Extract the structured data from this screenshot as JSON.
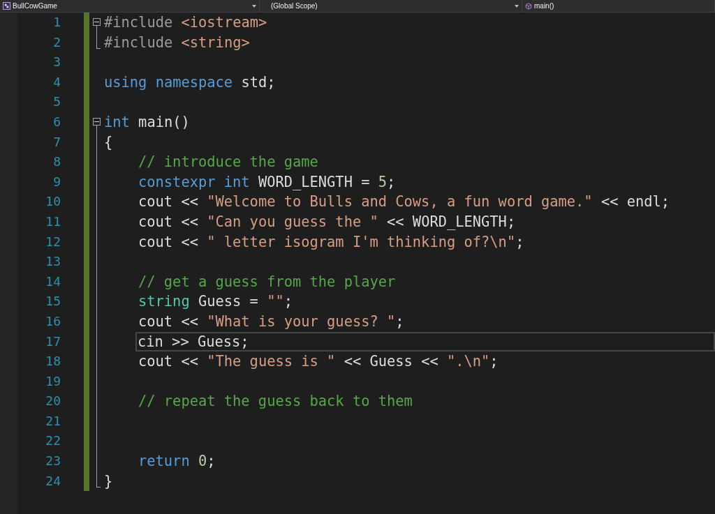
{
  "navigation_bar": {
    "project": "BullCowGame",
    "scope": "(Global Scope)",
    "member": "main()"
  },
  "lines": [
    {
      "number": "1",
      "changed": true,
      "fold_toggle": true,
      "in_block": false,
      "block_end": false,
      "indented": false,
      "tokens": [
        {
          "kind": "preprocessor",
          "text": "#include "
        },
        {
          "kind": "string",
          "text": "<iostream>"
        }
      ]
    },
    {
      "number": "2",
      "changed": true,
      "fold_toggle": false,
      "in_block": false,
      "block_end": true,
      "indented": false,
      "tokens": [
        {
          "kind": "preprocessor",
          "text": "#include "
        },
        {
          "kind": "string",
          "text": "<string>"
        }
      ]
    },
    {
      "number": "3",
      "changed": true,
      "fold_toggle": false,
      "in_block": false,
      "block_end": false,
      "indented": false
    },
    {
      "number": "4",
      "changed": true,
      "fold_toggle": false,
      "in_block": false,
      "block_end": false,
      "indented": false,
      "tokens": [
        {
          "kind": "keyword",
          "text": "using namespace "
        },
        {
          "kind": "plain",
          "text": "std;"
        }
      ]
    },
    {
      "number": "5",
      "changed": true,
      "fold_toggle": false,
      "in_block": false,
      "block_end": false,
      "indented": false
    },
    {
      "number": "6",
      "changed": true,
      "fold_toggle": true,
      "in_block": false,
      "block_end": false,
      "indented": false,
      "tokens": [
        {
          "kind": "keyword",
          "text": "int "
        },
        {
          "kind": "plain",
          "text": "main()"
        }
      ]
    },
    {
      "number": "7",
      "changed": true,
      "fold_toggle": false,
      "in_block": true,
      "block_end": false,
      "indented": false,
      "tokens": [
        {
          "kind": "plain",
          "text": "{"
        }
      ]
    },
    {
      "number": "8",
      "changed": true,
      "fold_toggle": false,
      "in_block": true,
      "block_end": false,
      "indented": true,
      "tokens": [
        {
          "kind": "comment",
          "text": "// introduce the game"
        }
      ]
    },
    {
      "number": "9",
      "changed": true,
      "fold_toggle": false,
      "in_block": true,
      "block_end": false,
      "indented": true,
      "tokens": [
        {
          "kind": "keyword",
          "text": "constexpr int "
        },
        {
          "kind": "plain",
          "text": "WORD_LENGTH = "
        },
        {
          "kind": "number",
          "text": "5"
        },
        {
          "kind": "plain",
          "text": ";"
        }
      ]
    },
    {
      "number": "10",
      "changed": true,
      "fold_toggle": false,
      "in_block": true,
      "block_end": false,
      "indented": true,
      "tokens": [
        {
          "kind": "plain",
          "text": "cout << "
        },
        {
          "kind": "string",
          "text": "\"Welcome to Bulls and Cows, a fun word game.\""
        },
        {
          "kind": "plain",
          "text": " << endl;"
        }
      ]
    },
    {
      "number": "11",
      "changed": true,
      "fold_toggle": false,
      "in_block": true,
      "block_end": false,
      "indented": true,
      "tokens": [
        {
          "kind": "plain",
          "text": "cout << "
        },
        {
          "kind": "string",
          "text": "\"Can you guess the \""
        },
        {
          "kind": "plain",
          "text": " << WORD_LENGTH;"
        }
      ]
    },
    {
      "number": "12",
      "changed": true,
      "fold_toggle": false,
      "in_block": true,
      "block_end": false,
      "indented": true,
      "tokens": [
        {
          "kind": "plain",
          "text": "cout << "
        },
        {
          "kind": "string",
          "text": "\" letter isogram I'm thinking of?\\n\""
        },
        {
          "kind": "plain",
          "text": ";"
        }
      ]
    },
    {
      "number": "13",
      "changed": true,
      "fold_toggle": false,
      "in_block": true,
      "block_end": false,
      "indented": false
    },
    {
      "number": "14",
      "changed": true,
      "fold_toggle": false,
      "in_block": true,
      "block_end": false,
      "indented": true,
      "tokens": [
        {
          "kind": "comment",
          "text": "// get a guess from the player"
        }
      ]
    },
    {
      "number": "15",
      "changed": true,
      "fold_toggle": false,
      "in_block": true,
      "block_end": false,
      "indented": true,
      "tokens": [
        {
          "kind": "type",
          "text": "string"
        },
        {
          "kind": "plain",
          "text": " Guess = "
        },
        {
          "kind": "string",
          "text": "\"\""
        },
        {
          "kind": "plain",
          "text": ";"
        }
      ]
    },
    {
      "number": "16",
      "changed": true,
      "fold_toggle": false,
      "in_block": true,
      "block_end": false,
      "indented": true,
      "tokens": [
        {
          "kind": "plain",
          "text": "cout << "
        },
        {
          "kind": "string",
          "text": "\"What is your guess? \""
        },
        {
          "kind": "plain",
          "text": ";"
        }
      ]
    },
    {
      "number": "17",
      "changed": true,
      "fold_toggle": false,
      "in_block": true,
      "block_end": false,
      "indented": true,
      "current": true,
      "tokens": [
        {
          "kind": "plain",
          "text": "cin >> Guess;"
        }
      ]
    },
    {
      "number": "18",
      "changed": true,
      "fold_toggle": false,
      "in_block": true,
      "block_end": false,
      "indented": true,
      "tokens": [
        {
          "kind": "plain",
          "text": "cout << "
        },
        {
          "kind": "string",
          "text": "\"The guess is \""
        },
        {
          "kind": "plain",
          "text": " << Guess << "
        },
        {
          "kind": "string",
          "text": "\".\\n\""
        },
        {
          "kind": "plain",
          "text": ";"
        }
      ]
    },
    {
      "number": "19",
      "changed": true,
      "fold_toggle": false,
      "in_block": true,
      "block_end": false,
      "indented": false
    },
    {
      "number": "20",
      "changed": true,
      "fold_toggle": false,
      "in_block": true,
      "block_end": false,
      "indented": true,
      "tokens": [
        {
          "kind": "comment",
          "text": "// repeat the guess back to them"
        }
      ]
    },
    {
      "number": "21",
      "changed": true,
      "fold_toggle": false,
      "in_block": true,
      "block_end": false,
      "indented": false
    },
    {
      "number": "22",
      "changed": true,
      "fold_toggle": false,
      "in_block": true,
      "block_end": false,
      "indented": false
    },
    {
      "number": "23",
      "changed": true,
      "fold_toggle": false,
      "in_block": true,
      "block_end": false,
      "indented": true,
      "tokens": [
        {
          "kind": "keyword",
          "text": "return "
        },
        {
          "kind": "number",
          "text": "0"
        },
        {
          "kind": "plain",
          "text": ";"
        }
      ]
    },
    {
      "number": "24",
      "changed": true,
      "fold_toggle": false,
      "in_block": false,
      "block_end": true,
      "indented": false,
      "tokens": [
        {
          "kind": "plain",
          "text": "}"
        }
      ]
    }
  ]
}
